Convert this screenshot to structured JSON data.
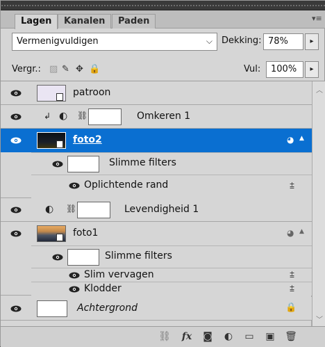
{
  "tabs": [
    {
      "label": "Lagen",
      "active": true
    },
    {
      "label": "Kanalen",
      "active": false
    },
    {
      "label": "Paden",
      "active": false
    }
  ],
  "blend_mode": "Vermenigvuldigen",
  "opacity_label": "Dekking:",
  "opacity_value": "78%",
  "lock_label": "Vergr.:",
  "fill_label": "Vul:",
  "fill_value": "100%",
  "layers": [
    {
      "name": "patroon"
    },
    {
      "name": "Omkeren 1"
    },
    {
      "name": "foto2",
      "selected": true
    },
    {
      "name": "Slimme filters"
    },
    {
      "name": "Oplichtende rand"
    },
    {
      "name": "Levendigheid 1"
    },
    {
      "name": "foto1"
    },
    {
      "name": "Slimme filters"
    },
    {
      "name": "Slim vervagen"
    },
    {
      "name": "Klodder"
    },
    {
      "name": "Achtergrond"
    }
  ],
  "icons": {
    "eye": "eye-icon",
    "link": "chain-link-icon",
    "fx": "fx",
    "lock": "lock-icon"
  },
  "colors": {
    "selection": "#0a6fd1",
    "panel": "#d6d6d6"
  }
}
